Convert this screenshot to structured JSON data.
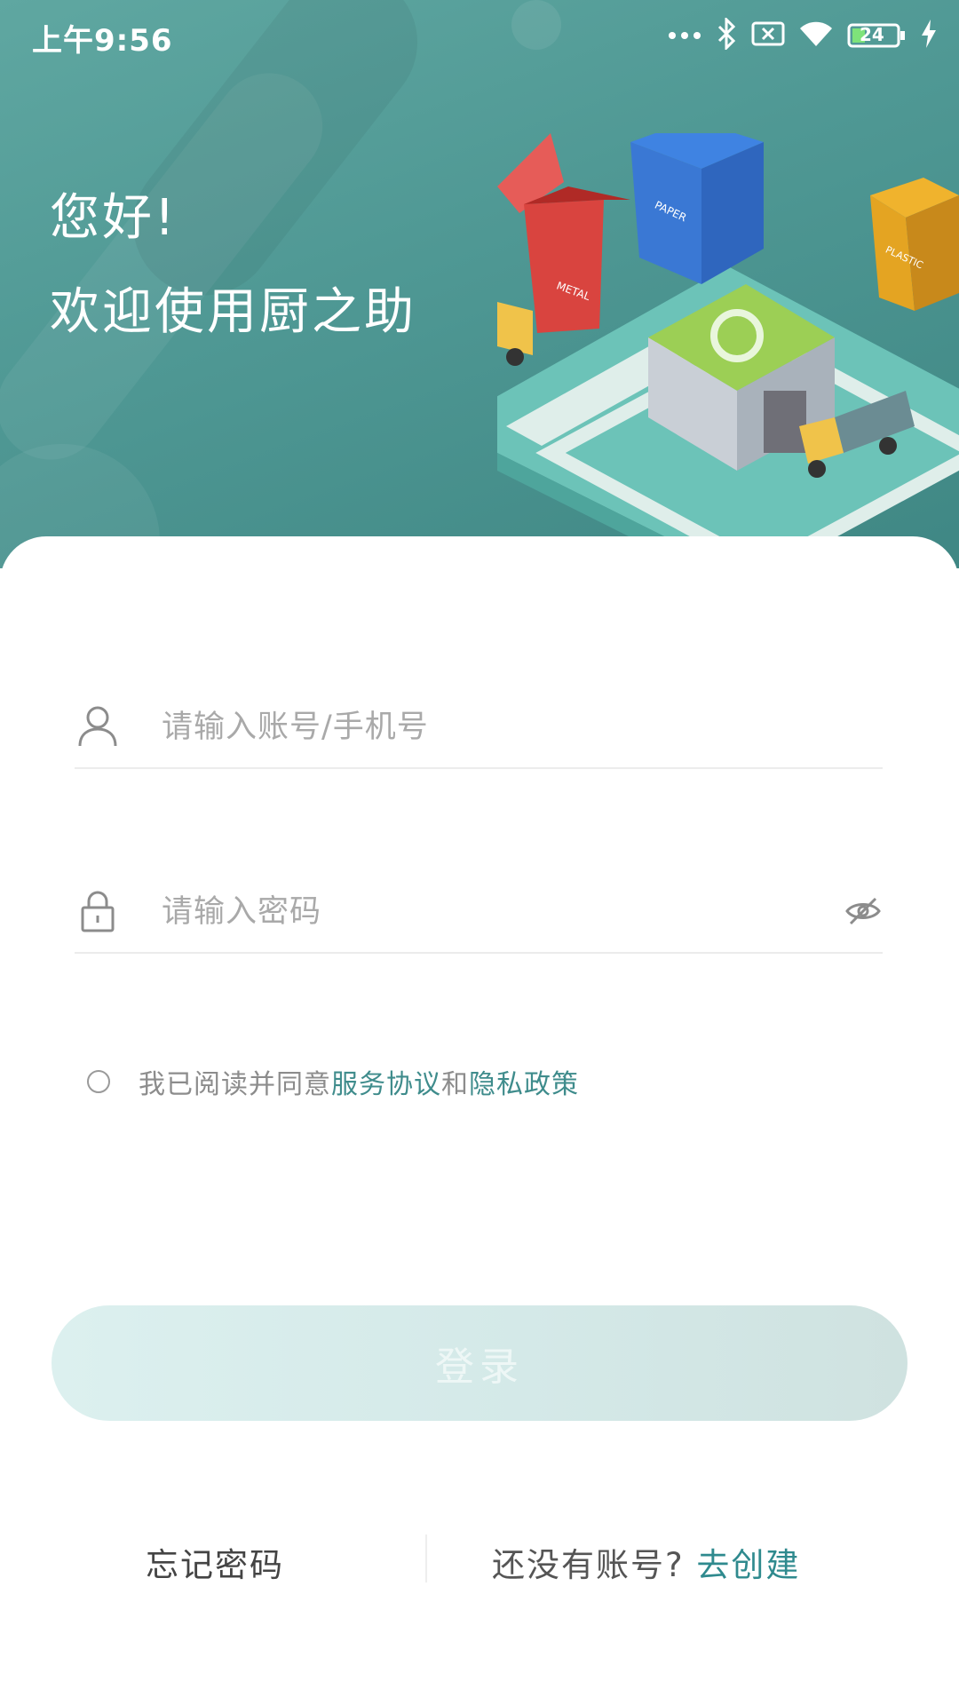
{
  "status_bar": {
    "time": "上午9:56",
    "battery": "24"
  },
  "header": {
    "greeting": "您好!",
    "welcome": "欢迎使用厨之助"
  },
  "illustration": {
    "bin_red_label": "METAL",
    "bin_blue_label": "PAPER",
    "bin_yellow_label": "PLASTIC"
  },
  "form": {
    "account_placeholder": "请输入账号/手机号",
    "password_placeholder": "请输入密码"
  },
  "agreement": {
    "prefix": "我已阅读并同意",
    "terms": "服务协议",
    "and": "和",
    "privacy": "隐私政策"
  },
  "login_label": "登录",
  "footer": {
    "forgot": "忘记密码",
    "signup_prompt": "还没有账号? ",
    "signup_link": "去创建"
  },
  "colors": {
    "hero": "#4f9894",
    "accent": "#2f8a8e"
  }
}
